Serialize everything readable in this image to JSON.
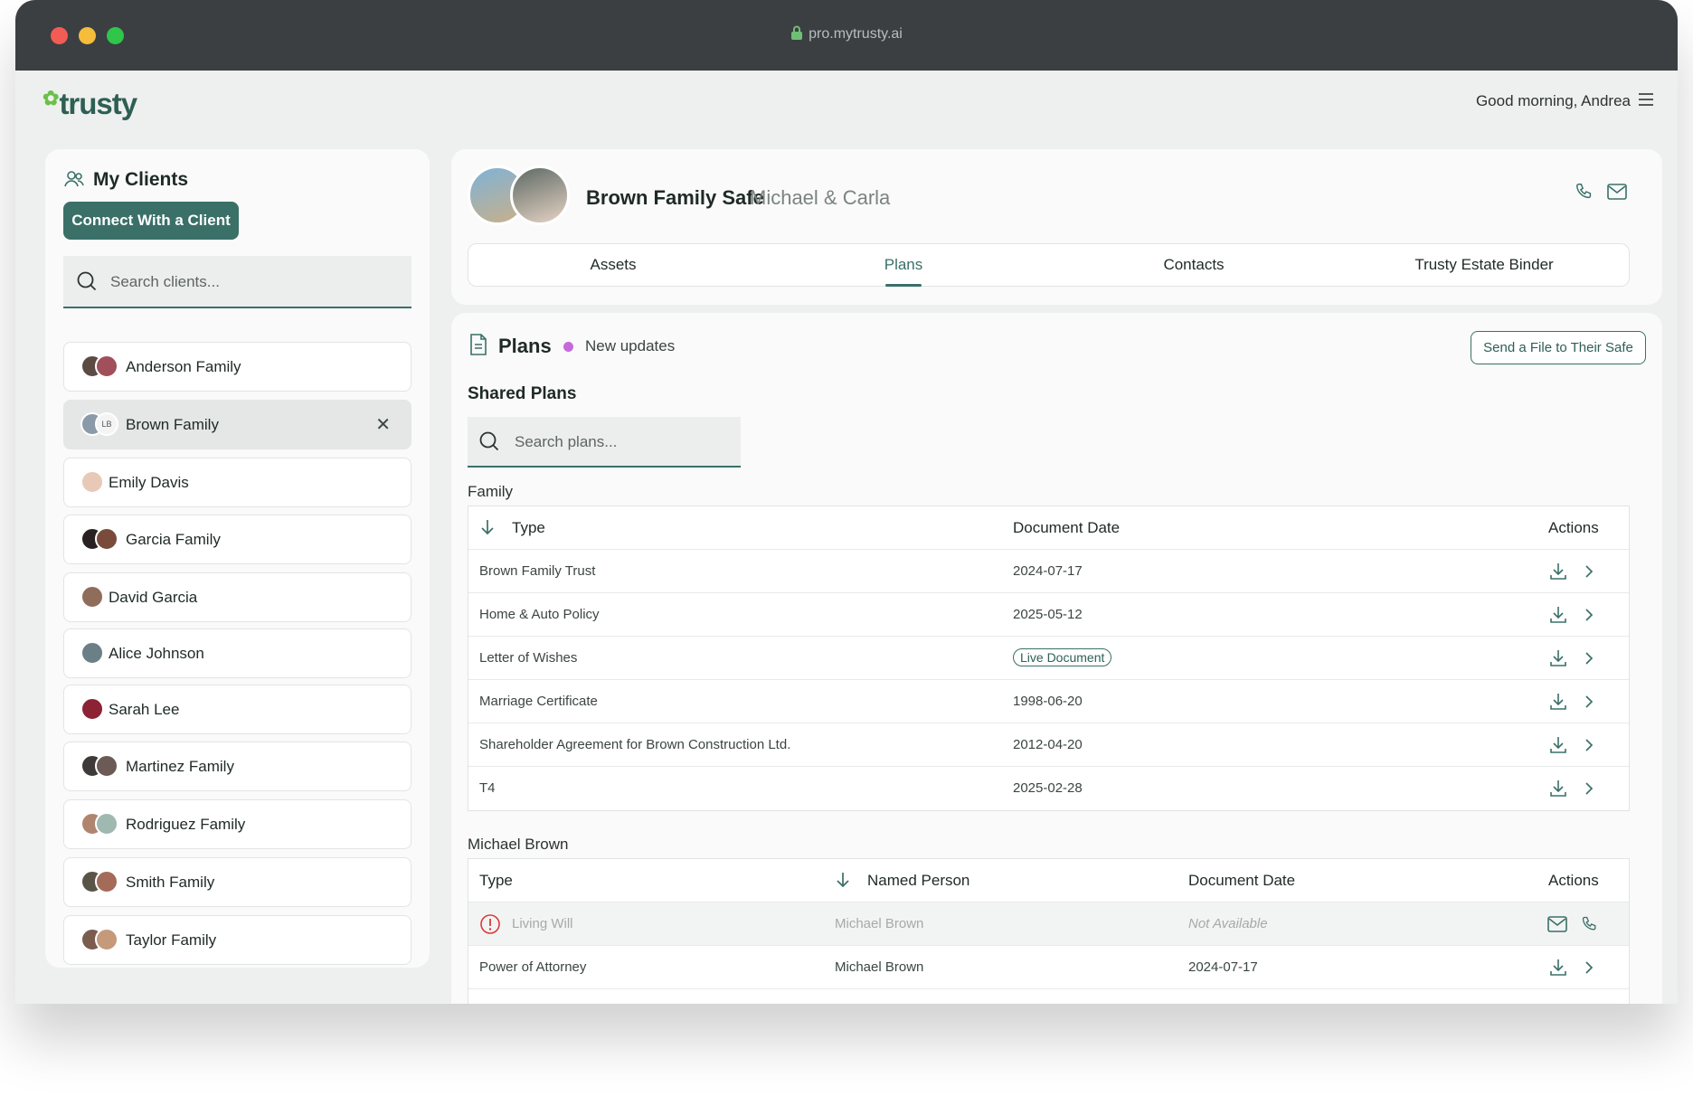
{
  "browser": {
    "url": "pro.mytrusty.ai"
  },
  "header": {
    "logo": "trusty",
    "greeting": "Good morning, Andrea"
  },
  "sidebar": {
    "title": "My Clients",
    "connect_label": "Connect With a Client",
    "search_placeholder": "Search clients...",
    "clients": [
      {
        "name": "Anderson Family"
      },
      {
        "name": "Brown Family",
        "avatar_initials": "LB"
      },
      {
        "name": "Emily Davis"
      },
      {
        "name": "Garcia Family"
      },
      {
        "name": "David Garcia"
      },
      {
        "name": "Alice Johnson"
      },
      {
        "name": "Sarah Lee"
      },
      {
        "name": "Martinez Family"
      },
      {
        "name": "Rodriguez Family"
      },
      {
        "name": "Smith Family"
      },
      {
        "name": "Taylor Family"
      }
    ]
  },
  "client_header": {
    "safe_name": "Brown Family Safe",
    "members": "Michael & Carla",
    "tabs": [
      "Assets",
      "Plans",
      "Contacts",
      "Trusty Estate Binder"
    ],
    "active_tab": "Plans"
  },
  "plans": {
    "title": "Plans",
    "updates_label": "New updates",
    "send_button": "Send a File to Their Safe",
    "shared_title": "Shared Plans",
    "search_placeholder": "Search plans...",
    "family": {
      "label": "Family",
      "headers": {
        "type": "Type",
        "date": "Document Date",
        "actions": "Actions"
      },
      "rows": [
        {
          "type": "Brown Family Trust",
          "date": "2024-07-17"
        },
        {
          "type": "Home & Auto Policy",
          "date": "2025-05-12"
        },
        {
          "type": "Letter of Wishes",
          "date": "Live Document"
        },
        {
          "type": "Marriage Certificate",
          "date": "1998-06-20"
        },
        {
          "type": "Shareholder Agreement for Brown Construction Ltd.",
          "date": "2012-04-20"
        },
        {
          "type": "T4",
          "date": "2025-02-28"
        }
      ]
    },
    "michael": {
      "label": "Michael Brown",
      "headers": {
        "type": "Type",
        "person": "Named Person",
        "date": "Document Date",
        "actions": "Actions"
      },
      "rows": [
        {
          "type": "Living Will",
          "person": "Michael Brown",
          "date": "Not Available"
        },
        {
          "type": "Power of Attorney",
          "person": "Michael Brown",
          "date": "2024-07-17"
        }
      ]
    }
  },
  "colors": {
    "accent": "#3a7068",
    "update_dot": "#c56ad9",
    "warning": "#d93a3a"
  }
}
